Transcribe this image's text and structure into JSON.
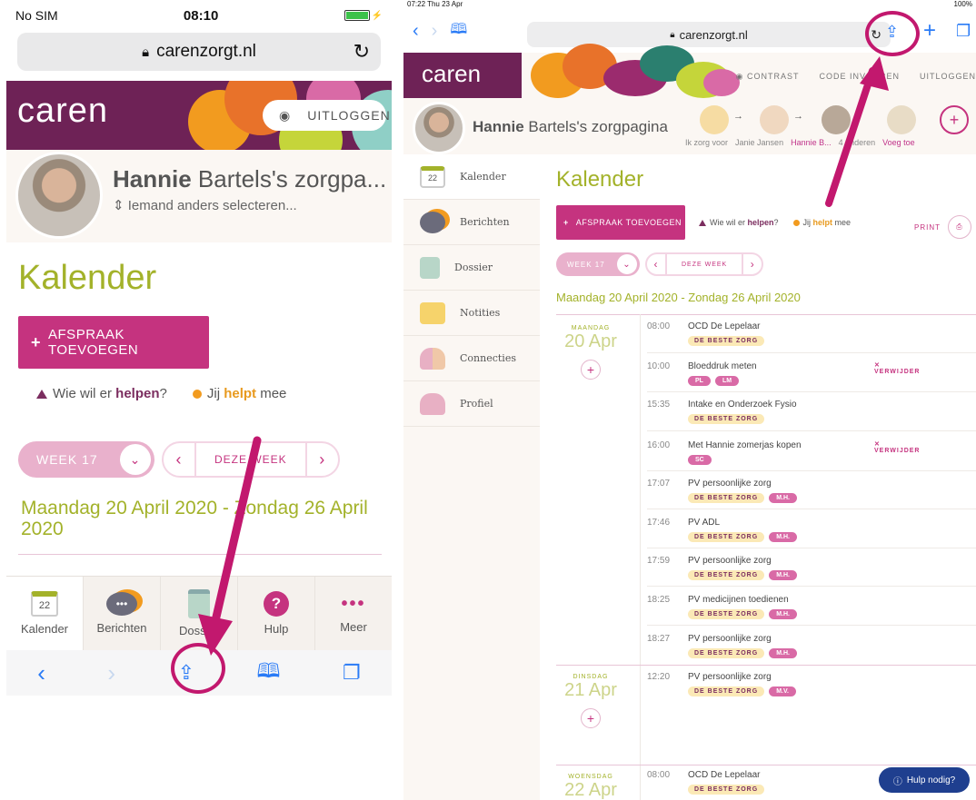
{
  "phone": {
    "status": {
      "carrier": "No SIM",
      "time": "08:10"
    },
    "url": "carenzorgt.nl",
    "logo": "caren",
    "logout": "UITLOGGEN",
    "name_bold": "Hannie",
    "name_rest": " Bartels's zorgpa...",
    "select_other": "Iemand anders selecteren...",
    "page_title": "Kalender",
    "add_button": "AFSPRAAK TOEVOEGEN",
    "legend": {
      "help_prefix": "Wie wil er ",
      "help_bold": "helpen",
      "help_suffix": "?",
      "you_prefix": "Jij ",
      "you_bold": "helpt",
      "you_suffix": " mee"
    },
    "week_label": "WEEK 17",
    "this_week": "DEZE WEEK",
    "date_range": "Maandag 20 April 2020 - Zondag 26 April 2020",
    "tabs": [
      {
        "label": "Kalender",
        "icon": "calendar-icon",
        "num": "22"
      },
      {
        "label": "Berichten",
        "icon": "chat-icon"
      },
      {
        "label": "Dossier",
        "icon": "clipboard-icon"
      },
      {
        "label": "Hulp",
        "icon": "help-icon"
      },
      {
        "label": "Meer",
        "icon": "more-icon"
      }
    ]
  },
  "tablet": {
    "status": {
      "time": "07:22  Thu 23 Apr",
      "battery": "100%"
    },
    "url": "carenzorgt.nl",
    "logo": "caren",
    "links": [
      "CONTRAST",
      "CODE INVOEREN",
      "UITLOGGEN"
    ],
    "name_bold": "Hannie",
    "name_rest": " Bartels's zorgpagina",
    "connections": [
      "Ik zorg voor",
      "Janie Jansen",
      "Hannie B...",
      "4 anderen",
      "Voeg toe"
    ],
    "sidebar": [
      "Kalender",
      "Berichten",
      "Dossier",
      "Notities",
      "Connecties",
      "Profiel"
    ],
    "calendar_num": "22",
    "page_title": "Kalender",
    "add_button": "AFSPRAAK TOEVOEGEN",
    "legend": {
      "help_prefix": "Wie wil er ",
      "help_bold": "helpen",
      "help_suffix": "?",
      "you_prefix": "Jij ",
      "you_bold": "helpt",
      "you_suffix": " mee"
    },
    "print": "PRINT",
    "week_label": "WEEK 17",
    "this_week": "DEZE WEEK",
    "date_range": "Maandag 20 April 2020 - Zondag 26 April 2020",
    "days": [
      {
        "name": "MAANDAG",
        "date": "20 Apr"
      },
      {
        "name": "DINSDAG",
        "date": "21 Apr"
      },
      {
        "name": "WOENSDAG",
        "date": "22 Apr"
      }
    ],
    "events": [
      {
        "time": "08:00",
        "title": "OCD De Lepelaar",
        "tags": [
          "DE BESTE ZORG"
        ],
        "people": []
      },
      {
        "time": "10:00",
        "title": "Bloeddruk meten",
        "tags": [],
        "people": [
          "PL",
          "LM"
        ],
        "delete": "✕ VERWIJDER"
      },
      {
        "time": "15:35",
        "title": "Intake en Onderzoek Fysio",
        "tags": [
          "DE BESTE ZORG"
        ],
        "people": []
      },
      {
        "time": "16:00",
        "title": "Met Hannie zomerjas kopen",
        "tags": [],
        "people": [
          "SC"
        ],
        "delete": "✕ VERWIJDER"
      },
      {
        "time": "17:07",
        "title": "PV persoonlijke zorg",
        "tags": [
          "DE BESTE ZORG"
        ],
        "people": [
          "M.H."
        ]
      },
      {
        "time": "17:46",
        "title": "PV ADL",
        "tags": [
          "DE BESTE ZORG"
        ],
        "people": [
          "M.H."
        ]
      },
      {
        "time": "17:59",
        "title": "PV persoonlijke zorg",
        "tags": [
          "DE BESTE ZORG"
        ],
        "people": [
          "M.H."
        ]
      },
      {
        "time": "18:25",
        "title": "PV medicijnen toedienen",
        "tags": [
          "DE BESTE ZORG"
        ],
        "people": [
          "M.H."
        ]
      },
      {
        "time": "18:27",
        "title": "PV persoonlijke zorg",
        "tags": [
          "DE BESTE ZORG"
        ],
        "people": [
          "M.H."
        ]
      },
      {
        "time": "12:20",
        "title": "PV persoonlijke zorg",
        "tags": [
          "DE BESTE ZORG"
        ],
        "people": [
          "M.V."
        ]
      },
      {
        "time": "08:00",
        "title": "OCD De Lepelaar",
        "tags": [
          "DE BESTE ZORG"
        ],
        "people": []
      }
    ],
    "help_button": "Hulp nodig?"
  },
  "colors": {
    "brand_purple": "#6e2256",
    "magenta": "#c5337f",
    "green": "#a3b22a",
    "annotation": "#c2186e"
  }
}
